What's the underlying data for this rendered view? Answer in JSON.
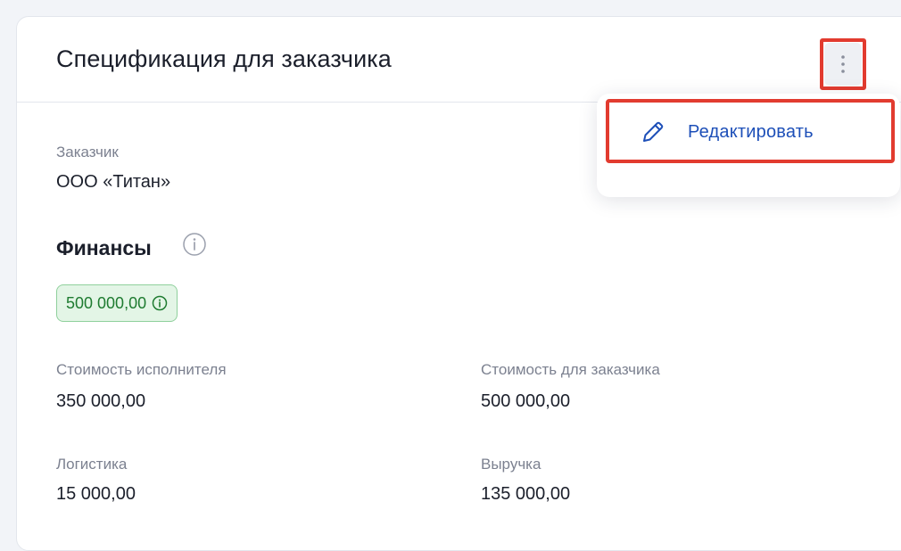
{
  "card": {
    "title": "Спецификация для заказчика"
  },
  "menu": {
    "kebab_icon": "vertical-dots-icon",
    "items": [
      {
        "label": "Редактировать",
        "icon": "pencil-icon"
      }
    ]
  },
  "customer": {
    "label": "Заказчик",
    "value": "ООО «Титан»"
  },
  "finance": {
    "title": "Финансы",
    "badge_value": "500 000,00",
    "fields": [
      {
        "label": "Стоимость исполнителя",
        "value": "350 000,00"
      },
      {
        "label": "Стоимость для заказчика",
        "value": "500 000,00"
      },
      {
        "label": "Логистика",
        "value": "15 000,00"
      },
      {
        "label": "Выручка",
        "value": "135 000,00"
      }
    ]
  },
  "colors": {
    "accent_blue": "#1d4fb8",
    "highlight_red": "#e23b2f",
    "badge_green_bg": "#e3f5e6",
    "badge_green_text": "#1e7b30"
  }
}
